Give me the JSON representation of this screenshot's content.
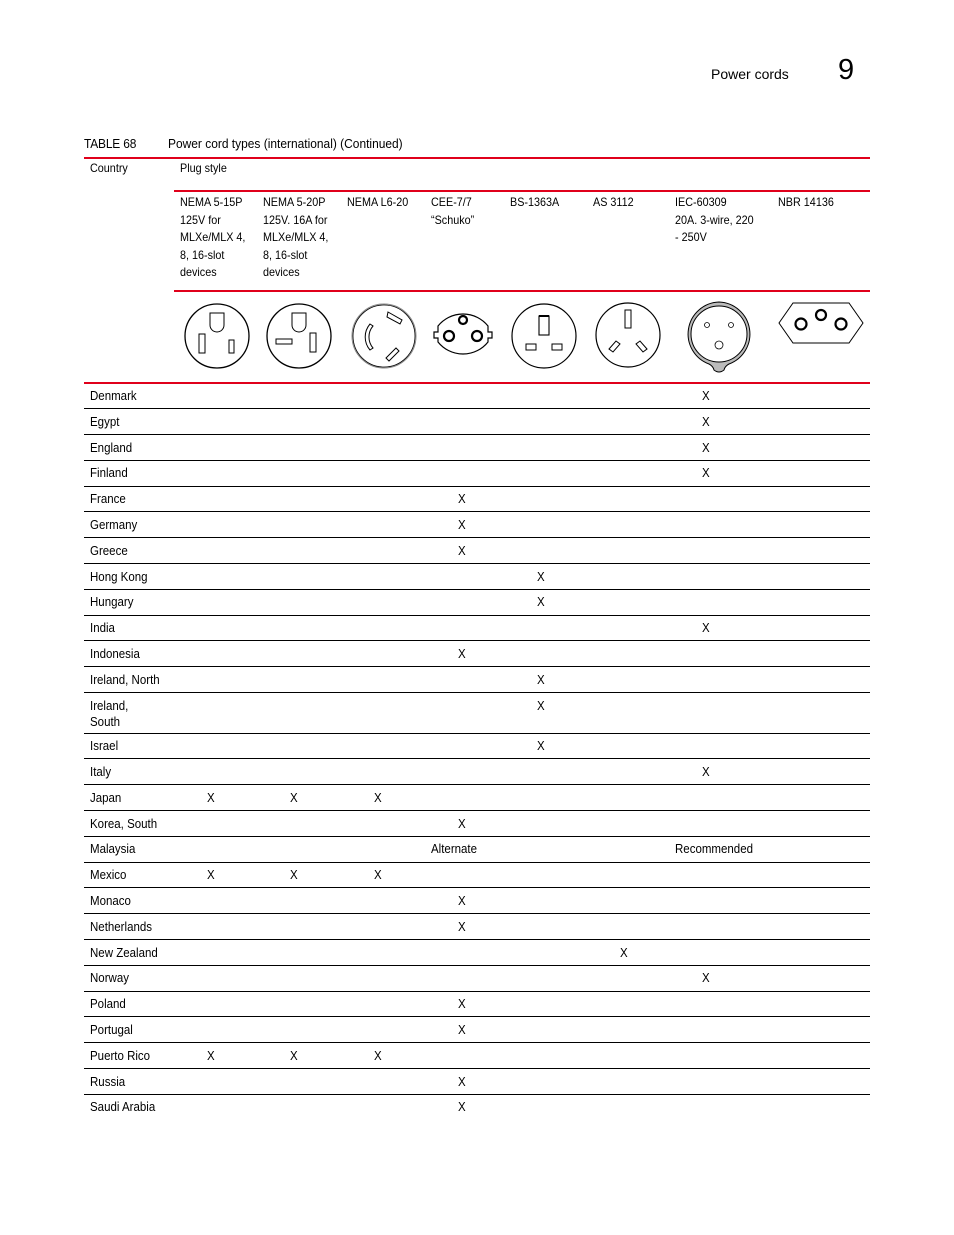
{
  "page_header": {
    "section_title": "Power cords",
    "chapter_number": "9"
  },
  "table": {
    "label": "TABLE 68",
    "title": "Power cord types (international)  (Continued)",
    "country_header": "Country",
    "plug_style_header": "Plug style",
    "columns": [
      {
        "id": "nema-5-15p",
        "lines": [
          "NEMA 5-15P",
          "125V for",
          "MLXe/MLX 4,",
          "8, 16-slot",
          "devices"
        ],
        "icon": "nema-5-15p-plug-icon"
      },
      {
        "id": "nema-5-20p",
        "lines": [
          "NEMA 5-20P",
          "125V. 16A for",
          "MLXe/MLX 4,",
          "8, 16-slot",
          "devices"
        ],
        "icon": "nema-5-20p-plug-icon"
      },
      {
        "id": "nema-l6-20",
        "lines": [
          "NEMA L6-20"
        ],
        "icon": "nema-l6-20-plug-icon"
      },
      {
        "id": "cee-7-7",
        "lines": [
          "CEE-7/7",
          "“Schuko”"
        ],
        "icon": "schuko-plug-icon"
      },
      {
        "id": "bs-1363a",
        "lines": [
          "BS-1363A"
        ],
        "icon": "bs-1363a-plug-icon"
      },
      {
        "id": "as-3112",
        "lines": [
          "AS 3112"
        ],
        "icon": "as-3112-plug-icon"
      },
      {
        "id": "iec-60309",
        "lines": [
          "IEC-60309",
          "20A. 3-wire, 220",
          "- 250V"
        ],
        "icon": "iec-60309-plug-icon"
      },
      {
        "id": "nbr-14136",
        "lines": [
          "NBR 14136"
        ],
        "icon": "nbr-14136-plug-icon"
      }
    ],
    "rows": [
      {
        "country": "Denmark",
        "marks": [
          "",
          "",
          "",
          "",
          "",
          "",
          "X",
          ""
        ]
      },
      {
        "country": "Egypt",
        "marks": [
          "",
          "",
          "",
          "",
          "",
          "",
          "X",
          ""
        ]
      },
      {
        "country": "England",
        "marks": [
          "",
          "",
          "",
          "",
          "",
          "",
          "X",
          ""
        ]
      },
      {
        "country": "Finland",
        "marks": [
          "",
          "",
          "",
          "",
          "",
          "",
          "X",
          ""
        ]
      },
      {
        "country": "France",
        "marks": [
          "",
          "",
          "",
          "X",
          "",
          "",
          "",
          ""
        ]
      },
      {
        "country": "Germany",
        "marks": [
          "",
          "",
          "",
          "X",
          "",
          "",
          "",
          ""
        ]
      },
      {
        "country": "Greece",
        "marks": [
          "",
          "",
          "",
          "X",
          "",
          "",
          "",
          ""
        ]
      },
      {
        "country": "Hong Kong",
        "marks": [
          "",
          "",
          "",
          "",
          "X",
          "",
          "",
          ""
        ]
      },
      {
        "country": "Hungary",
        "marks": [
          "",
          "",
          "",
          "",
          "X",
          "",
          "",
          ""
        ]
      },
      {
        "country": "India",
        "marks": [
          "",
          "",
          "",
          "",
          "",
          "",
          "X",
          ""
        ]
      },
      {
        "country": "Indonesia",
        "marks": [
          "",
          "",
          "",
          "X",
          "",
          "",
          "",
          ""
        ]
      },
      {
        "country": "Ireland, North",
        "marks": [
          "",
          "",
          "",
          "",
          "X",
          "",
          "",
          ""
        ]
      },
      {
        "country": "Ireland,\nSouth",
        "marks": [
          "",
          "",
          "",
          "",
          "X",
          "",
          "",
          ""
        ]
      },
      {
        "country": "Israel",
        "marks": [
          "",
          "",
          "",
          "",
          "X",
          "",
          "",
          ""
        ]
      },
      {
        "country": "Italy",
        "marks": [
          "",
          "",
          "",
          "",
          "",
          "",
          "X",
          ""
        ]
      },
      {
        "country": "Japan",
        "marks": [
          "X",
          "X",
          "X",
          "",
          "",
          "",
          "",
          ""
        ]
      },
      {
        "country": "Korea, South",
        "marks": [
          "",
          "",
          "",
          "X",
          "",
          "",
          "",
          ""
        ]
      },
      {
        "country": "Malaysia",
        "marks": [
          "",
          "",
          "",
          "Alternate",
          "",
          "",
          "Recommended",
          ""
        ]
      },
      {
        "country": "Mexico",
        "marks": [
          "X",
          "X",
          "X",
          "",
          "",
          "",
          "",
          ""
        ]
      },
      {
        "country": "Monaco",
        "marks": [
          "",
          "",
          "",
          "X",
          "",
          "",
          "",
          ""
        ]
      },
      {
        "country": "Netherlands",
        "marks": [
          "",
          "",
          "",
          "X",
          "",
          "",
          "",
          ""
        ]
      },
      {
        "country": "New Zealand",
        "marks": [
          "",
          "",
          "",
          "",
          "",
          "X",
          "",
          ""
        ]
      },
      {
        "country": "Norway",
        "marks": [
          "",
          "",
          "",
          "",
          "",
          "",
          "X",
          ""
        ]
      },
      {
        "country": "Poland",
        "marks": [
          "",
          "",
          "",
          "X",
          "",
          "",
          "",
          ""
        ]
      },
      {
        "country": "Portugal",
        "marks": [
          "",
          "",
          "",
          "X",
          "",
          "",
          "",
          ""
        ]
      },
      {
        "country": "Puerto Rico",
        "marks": [
          "X",
          "X",
          "X",
          "",
          "",
          "",
          "",
          ""
        ]
      },
      {
        "country": "Russia",
        "marks": [
          "",
          "",
          "",
          "X",
          "",
          "",
          "",
          ""
        ]
      },
      {
        "country": "Saudi Arabia",
        "marks": [
          "",
          "",
          "",
          "X",
          "",
          "",
          "",
          ""
        ]
      }
    ]
  },
  "colors": {
    "accent_rule": "#e0001b",
    "row_rule": "#000000"
  }
}
